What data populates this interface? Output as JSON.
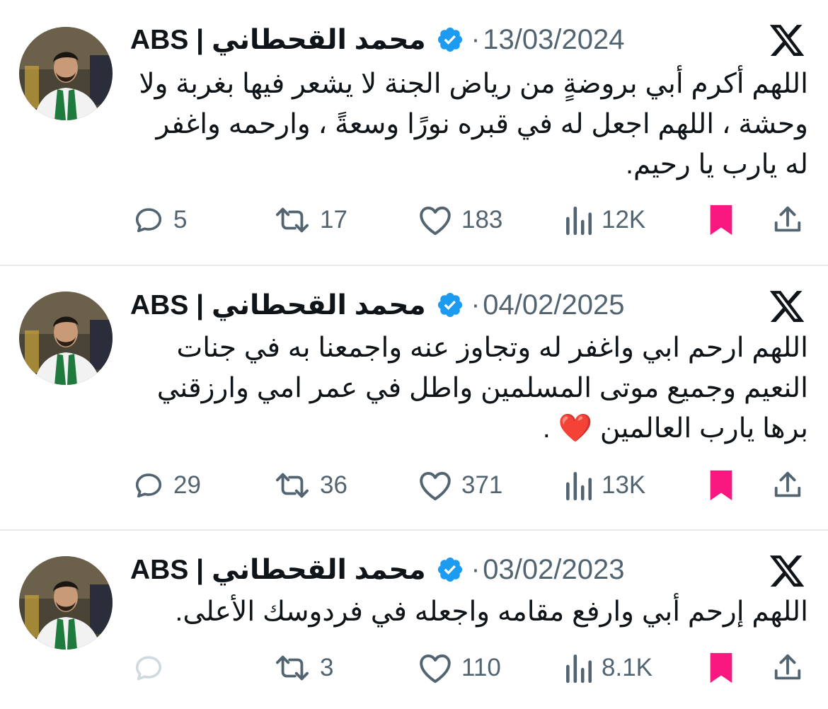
{
  "colors": {
    "text": "#0f1419",
    "muted": "#536471",
    "verified": "#1d9bf0",
    "bookmark": "#f91880",
    "divider": "#e6e8ea"
  },
  "tweets": [
    {
      "author_name": "ABS | محمد القحطاني",
      "date": "13/03/2024",
      "text": "اللهم أكرم أبي بروضةٍ من رياض الجنة لا يشعر فيها بغربة ولا وحشة ، اللهم اجعل له في قبره نورًا وسعةً ، وارحمه واغفر له يارب يا رحيم.",
      "replies": "5",
      "reposts": "17",
      "likes": "183",
      "views": "12K",
      "bookmarked": true
    },
    {
      "author_name": "ABS | محمد القحطاني",
      "date": "04/02/2025",
      "text": "اللهم ارحم ابي واغفر له وتجاوز عنه واجمعنا به في جنات النعيم وجميع موتى المسلمين واطل في عمر امي وارزقني برها يارب العالمين ❤️ .",
      "replies": "29",
      "reposts": "36",
      "likes": "371",
      "views": "13K",
      "bookmarked": true
    },
    {
      "author_name": "ABS | محمد القحطاني",
      "date": "03/02/2023",
      "text": "اللهم إرحم أبي وارفع مقامه واجعله في فردوسك الأعلى.",
      "replies": "",
      "reposts": "3",
      "likes": "110",
      "views": "8.1K",
      "bookmarked": true
    }
  ]
}
